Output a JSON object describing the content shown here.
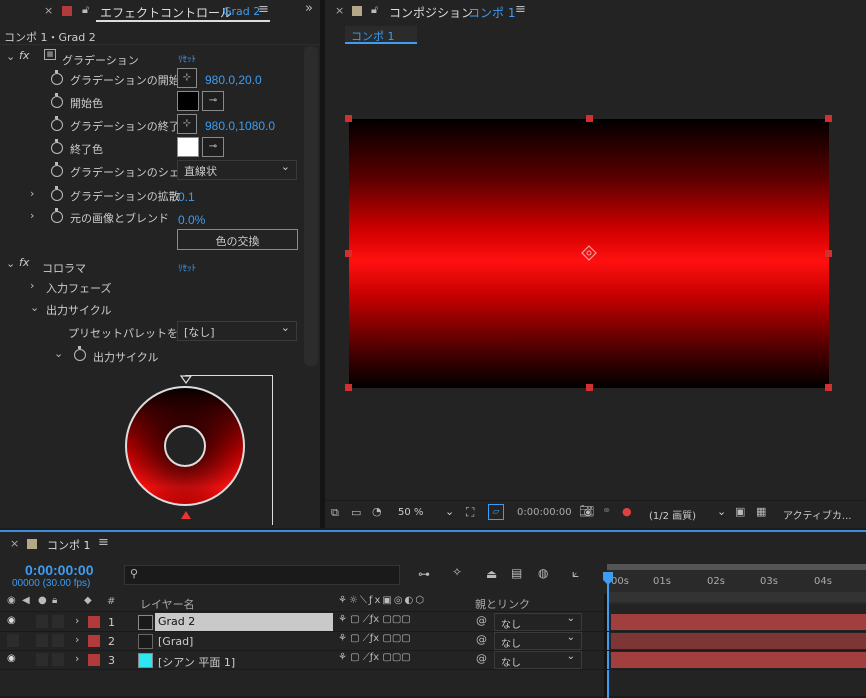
{
  "effect_panel": {
    "tab_title": "エフェクトコントロール",
    "tab_layer": "Grad 2",
    "breadcrumb": "コンポ 1・Grad 2",
    "effects": [
      {
        "name": "グラデーション",
        "reset": "ﾘｾｯﾄ",
        "props": [
          {
            "label": "グラデーションの開始",
            "value": "980.0,20.0"
          },
          {
            "label": "開始色"
          },
          {
            "label": "グラデーションの終了",
            "value": "980.0,1080.0"
          },
          {
            "label": "終了色"
          },
          {
            "label": "グラデーションのシェ",
            "value": "直線状"
          },
          {
            "label": "グラデーションの拡散",
            "value": "0.1"
          },
          {
            "label": "元の画像とブレンド",
            "value": "0.0%"
          }
        ],
        "swap_button": "色の交換"
      },
      {
        "name": "コロラマ",
        "reset": "ﾘｾｯﾄ",
        "sections": [
          "入力フェーズ",
          "出力サイクル"
        ],
        "preset_label": "プリセットパレットを使",
        "preset_value": "[なし]",
        "cycle_label": "出力サイクル"
      }
    ]
  },
  "comp_panel": {
    "tab_title": "コンポジション",
    "tab_comp": "コンポ 1",
    "flow_tab": "コンポ 1",
    "zoom": "50 %",
    "timecode": "0:00:00:00",
    "resolution": "(1/2 画質)",
    "camera": "アクティブカ..."
  },
  "timeline": {
    "tab_title": "コンポ 1",
    "timecode": "0:00:00:00",
    "frames": "00000 (30.00 fps)",
    "search_placeholder": "",
    "col_number": "#",
    "col_layer": "レイヤー名",
    "col_parent": "親とリンク",
    "ruler": [
      "00s",
      "01s",
      "02s",
      "03s",
      "04s"
    ],
    "layers": [
      {
        "num": "1",
        "name": "Grad 2",
        "color": "#b33a3a",
        "swatch": "#1a1a1a",
        "parent": "なし",
        "visible": true
      },
      {
        "num": "2",
        "name": "[Grad]",
        "color": "#b33a3a",
        "swatch": "#1a1a1a",
        "parent": "なし",
        "visible": false
      },
      {
        "num": "3",
        "name": "[シアン 平面 1]",
        "color": "#b33a3a",
        "swatch": "#2ee6f0",
        "parent": "なし",
        "visible": true
      }
    ]
  },
  "colors": {
    "accent": "#3f9cf0",
    "label_red": "#b33a3a",
    "selection": "#ccc"
  }
}
